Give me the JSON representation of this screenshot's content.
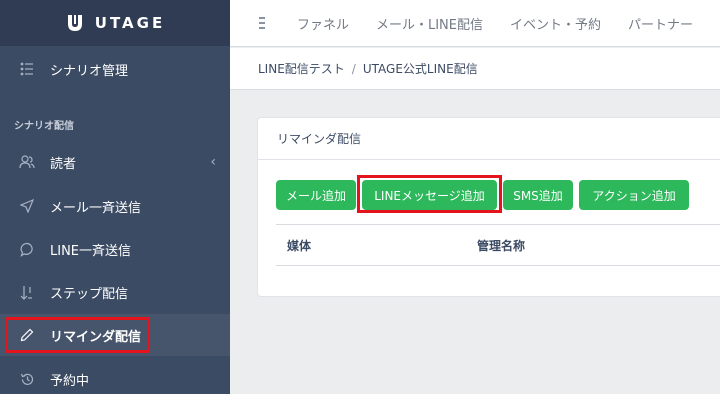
{
  "brand": {
    "name": "UTAGE"
  },
  "sidebar": {
    "top_item": {
      "label": "シナリオ管理",
      "icon": "list-icon"
    },
    "section_title": "シナリオ配信",
    "items": [
      {
        "label": "読者",
        "icon": "users-icon"
      },
      {
        "label": "メール一斉送信",
        "icon": "send-icon"
      },
      {
        "label": "LINE一斉送信",
        "icon": "chat-icon"
      },
      {
        "label": "ステップ配信",
        "icon": "sort-icon"
      },
      {
        "label": "リマインダ配信",
        "icon": "pencil-icon"
      },
      {
        "label": "予約中",
        "icon": "history-icon"
      }
    ],
    "chevron": "‹"
  },
  "header": {
    "links": [
      "ファネル",
      "メール・LINE配信",
      "イベント・予約",
      "パートナー"
    ]
  },
  "breadcrumb": {
    "items": [
      "LINE配信テスト",
      "UTAGE公式LINE配信"
    ],
    "separator": "/"
  },
  "card": {
    "title": "リマインダ配信",
    "buttons": [
      "メール追加",
      "LINEメッセージ追加",
      "SMS追加",
      "アクション追加"
    ],
    "columns": [
      "媒体",
      "管理名称"
    ]
  },
  "colors": {
    "sidebar": "#3c4b64",
    "button": "#2eb85c",
    "highlight": "#e4141d"
  }
}
